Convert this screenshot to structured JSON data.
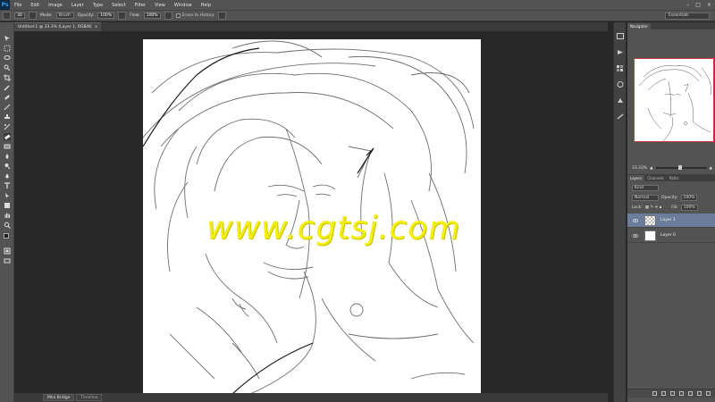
{
  "app": {
    "logo": "Ps"
  },
  "menu": [
    "File",
    "Edit",
    "Image",
    "Layer",
    "Type",
    "Select",
    "Filter",
    "View",
    "Window",
    "Help"
  ],
  "window_controls": [
    "–",
    "□",
    "×"
  ],
  "options_bar": {
    "brush_size": "30",
    "mode_label": "Mode:",
    "mode_value": "Brush",
    "opacity_label": "Opacity:",
    "opacity_value": "100%",
    "flow_label": "Flow:",
    "flow_value": "100%",
    "erase_history_label": "Erase to History"
  },
  "workspace": "Essentials",
  "document_tab": {
    "title": "Untitled-1 @ 33.3% (Layer 1, RGB/8)",
    "close": "×"
  },
  "bottom_tabs": [
    {
      "label": "Mini Bridge",
      "active": true
    },
    {
      "label": "Timeline",
      "active": false
    }
  ],
  "navigator": {
    "tab": "Navigator",
    "zoom": "33.33%"
  },
  "layers_panel": {
    "tabs": [
      "Layers",
      "Channels",
      "Paths"
    ],
    "kind_label": "Kind",
    "blend_mode": "Normal",
    "opacity_label": "Opacity:",
    "opacity_value": "100%",
    "lock_label": "Lock:",
    "fill_label": "Fill:",
    "fill_value": "100%",
    "layers": [
      {
        "name": "Layer 1",
        "selected": true,
        "thumb": "transparent"
      },
      {
        "name": "Layer 0",
        "selected": false,
        "thumb": "white"
      }
    ]
  },
  "watermark": "www.cgtsj.com",
  "colors": {
    "selection": "#6c7d9b",
    "watermark": "#f3ee16",
    "panel": "#535353",
    "workspace_bg": "#282828"
  }
}
